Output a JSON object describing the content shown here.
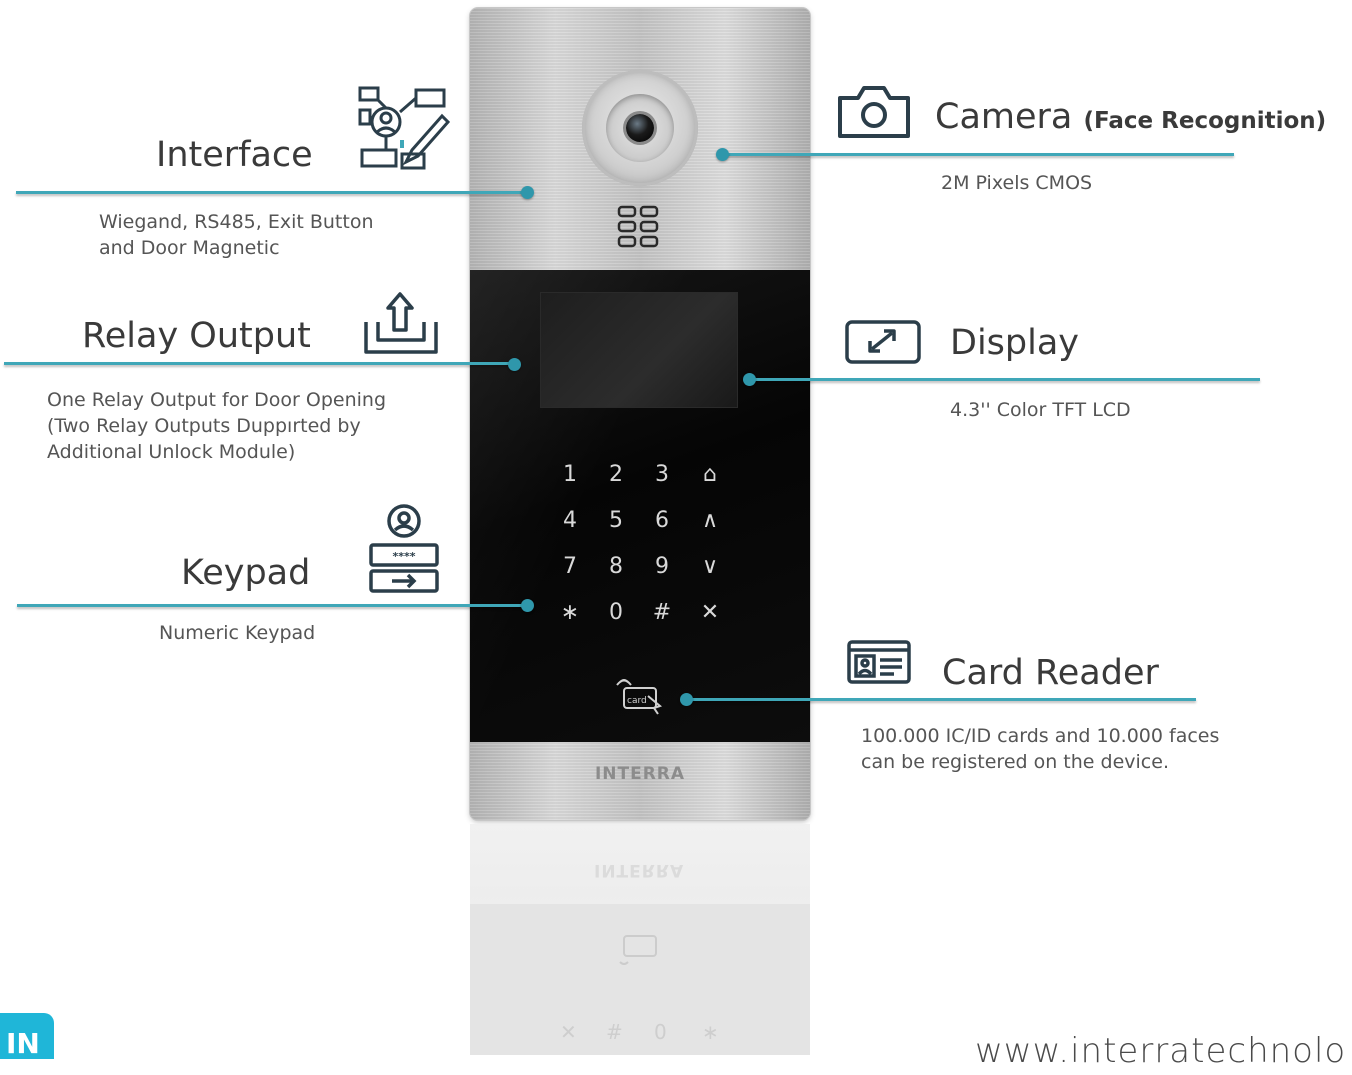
{
  "device": {
    "brand": "INTERRA",
    "keys": [
      "1",
      "2",
      "3",
      "⌂",
      "4",
      "5",
      "6",
      "∧",
      "7",
      "8",
      "9",
      "∨",
      "∗",
      "0",
      "#",
      "✕"
    ],
    "card_label": "card",
    "reflection_keys": [
      "✕",
      "#",
      "0",
      "∗"
    ],
    "reflection_brand": "INTERRA"
  },
  "features": {
    "interface": {
      "title": "Interface",
      "desc": [
        "Wiegand, RS485, Exit Button",
        "and Door Magnetic"
      ]
    },
    "relay": {
      "title": "Relay Output",
      "desc": [
        "One Relay Output for Door Opening",
        "(Two Relay Outputs Duppırted by",
        "Additional Unlock Module)"
      ]
    },
    "keypad": {
      "title": "Keypad",
      "desc": [
        "Numeric Keypad"
      ],
      "code": "****"
    },
    "camera": {
      "title": "Camera",
      "subtitle": "(Face Recognition)",
      "desc": [
        "2M Pixels CMOS"
      ]
    },
    "display": {
      "title": "Display",
      "desc": [
        "4.3'' Color TFT LCD"
      ]
    },
    "card_reader": {
      "title": "Card Reader",
      "desc": [
        "100.000 IC/ID cards and 10.000 faces",
        "can be registered on the device."
      ]
    }
  },
  "footer": {
    "url": "www.interratechnolo",
    "logo": "IN"
  },
  "colors": {
    "accent": "#3fa7b8",
    "dot": "#2f97ab",
    "text": "#3a3a3a",
    "icon": "#2b3e4a"
  },
  "icons": [
    "interface-icon",
    "relay-output-icon",
    "keypad-icon",
    "camera-icon",
    "display-icon",
    "card-reader-icon",
    "speaker-icon",
    "card-tap-icon"
  ]
}
